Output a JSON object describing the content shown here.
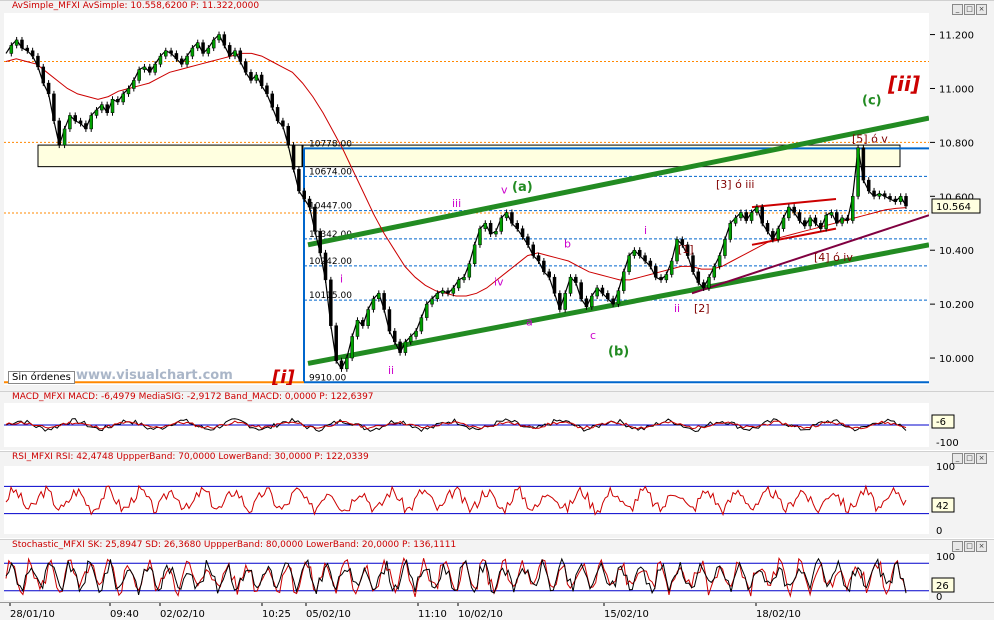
{
  "window": {
    "main_title": "AvSimple_MFXI AvSimple: 10.558,6200  P: 11.322,0000",
    "macd_title": "MACD_MFXI MACD: -6,4979  MediaSIG: -2,9172  Band_MACD: 0,0000  P: 122,6397",
    "rsi_title": "RSI_MFXI RSI: 42,4748  UppperBand: 70,0000  LowerBand: 30,0000  P: 122,0339",
    "stoch_title": "Stochastic_MFXI SK: 25,8947  SD: 26,3680  UppperBand: 80,0000  LowerBand: 20,0000  P: 136,1111",
    "controls": [
      "_",
      "□",
      "×"
    ],
    "sin_ordenes": "Sin órdenes",
    "watermark": "www.visualchart.com"
  },
  "colors": {
    "price": "#000000",
    "candle_up": "#00a000",
    "ma": "#cc0000",
    "trend_green": "#228b22",
    "trend_purple": "#800040",
    "wave_magenta": "#cc00cc",
    "wave_red": "#cc0000",
    "wave_darkred": "#800000",
    "hline_blue": "#0066cc",
    "hline_orange": "#ff8800",
    "osc_blue": "#0000cc"
  },
  "chart_data": [
    {
      "type": "line",
      "panel": "price",
      "y_ticks": [
        "11.200",
        "11.000",
        "10.800",
        "10.600",
        "10.400",
        "10.200",
        "10.000"
      ],
      "last_value": "10.564",
      "ylim": [
        9900,
        11280
      ],
      "price_series": [
        11130,
        11160,
        11180,
        11150,
        11140,
        11120,
        11080,
        11020,
        10980,
        10880,
        10790,
        10850,
        10900,
        10880,
        10870,
        10850,
        10900,
        10920,
        10940,
        10910,
        10960,
        10950,
        10980,
        11000,
        11030,
        11070,
        11080,
        11060,
        11090,
        11120,
        11140,
        11130,
        11110,
        11090,
        11120,
        11150,
        11170,
        11130,
        11150,
        11180,
        11200,
        11160,
        11120,
        11140,
        11100,
        11060,
        11030,
        11050,
        11010,
        10980,
        10930,
        10880,
        10860,
        10790,
        10700,
        10620,
        10590,
        10560,
        10470,
        10390,
        10290,
        10120,
        9990,
        9960,
        10000,
        10080,
        10140,
        10120,
        10180,
        10220,
        10240,
        10180,
        10100,
        10060,
        10020,
        10060,
        10080,
        10100,
        10150,
        10200,
        10220,
        10240,
        10250,
        10240,
        10260,
        10290,
        10300,
        10350,
        10420,
        10480,
        10500,
        10460,
        10470,
        10520,
        10540,
        10500,
        10480,
        10450,
        10420,
        10380,
        10360,
        10320,
        10300,
        10240,
        10180,
        10240,
        10300,
        10280,
        10220,
        10190,
        10230,
        10260,
        10240,
        10220,
        10200,
        10250,
        10320,
        10380,
        10400,
        10380,
        10360,
        10340,
        10300,
        10290,
        10310,
        10360,
        10440,
        10420,
        10380,
        10320,
        10280,
        10260,
        10300,
        10340,
        10380,
        10440,
        10500,
        10520,
        10540,
        10510,
        10540,
        10560,
        10500,
        10470,
        10440,
        10480,
        10520,
        10560,
        10540,
        10510,
        10490,
        10520,
        10500,
        10480,
        10530,
        10540,
        10500,
        10520,
        10510,
        10600,
        10780,
        10660,
        10620,
        10600,
        10610,
        10600,
        10590,
        10580,
        10600,
        10564
      ],
      "ma_series": [
        11100,
        11110,
        11100,
        11090,
        11060,
        11030,
        11000,
        10980,
        10970,
        10960,
        10970,
        10990,
        11000,
        11010,
        11020,
        11040,
        11060,
        11070,
        11080,
        11090,
        11100,
        11110,
        11120,
        11130,
        11130,
        11120,
        11100,
        11080,
        11060,
        11020,
        10970,
        10910,
        10840,
        10770,
        10690,
        10610,
        10530,
        10460,
        10400,
        10340,
        10300,
        10270,
        10250,
        10240,
        10230,
        10230,
        10240,
        10260,
        10290,
        10320,
        10350,
        10380,
        10390,
        10380,
        10370,
        10360,
        10340,
        10320,
        10310,
        10300,
        10290,
        10290,
        10300,
        10310,
        10320,
        10330,
        10340,
        10340,
        10330,
        10330,
        10340,
        10360,
        10380,
        10400,
        10420,
        10440,
        10450,
        10460,
        10470,
        10480,
        10490,
        10500,
        10510,
        10520,
        10530,
        10540,
        10550,
        10555,
        10558
      ],
      "hlines": [
        {
          "value": 10778,
          "label": "10778.00",
          "style": "solid"
        },
        {
          "value": 10674,
          "label": "10674.00",
          "style": "dashed"
        },
        {
          "value": 10547,
          "label": "10447.00",
          "style": "dashed"
        },
        {
          "value": 10442,
          "label": "10342.00",
          "style": "dashed"
        },
        {
          "value": 10342,
          "label": "10242.00",
          "style": "dashed"
        },
        {
          "value": 10215,
          "label": "10115.00",
          "style": "dashed"
        },
        {
          "value": 9910,
          "label": "9910.00",
          "style": "solid"
        }
      ],
      "wave_labels": [
        "[i]",
        "[ii]",
        "(a)",
        "(b)",
        "(c)",
        "i",
        "ii",
        "iii",
        "iv",
        "v",
        "a",
        "b",
        "c",
        "[1]",
        "[2]",
        "[3] ó iii",
        "[4] ó iv",
        "[5] ó v"
      ]
    },
    {
      "type": "line",
      "panel": "macd",
      "y_ticks": [
        "-6",
        "-100"
      ],
      "last_value": "-6"
    },
    {
      "type": "line",
      "panel": "rsi",
      "y_ticks": [
        "100",
        "42",
        "0"
      ],
      "bands": [
        70,
        30
      ],
      "last_value": "42"
    },
    {
      "type": "line",
      "panel": "stochastic",
      "y_ticks": [
        "100",
        "26",
        "0"
      ],
      "bands": [
        80,
        20
      ],
      "last_value": "26"
    }
  ],
  "x_labels": [
    "28/01/10",
    "09:40",
    "02/02/10",
    "10:25",
    "05/02/10",
    "11:10",
    "10/02/10",
    "15/02/10",
    "18/02/10"
  ]
}
